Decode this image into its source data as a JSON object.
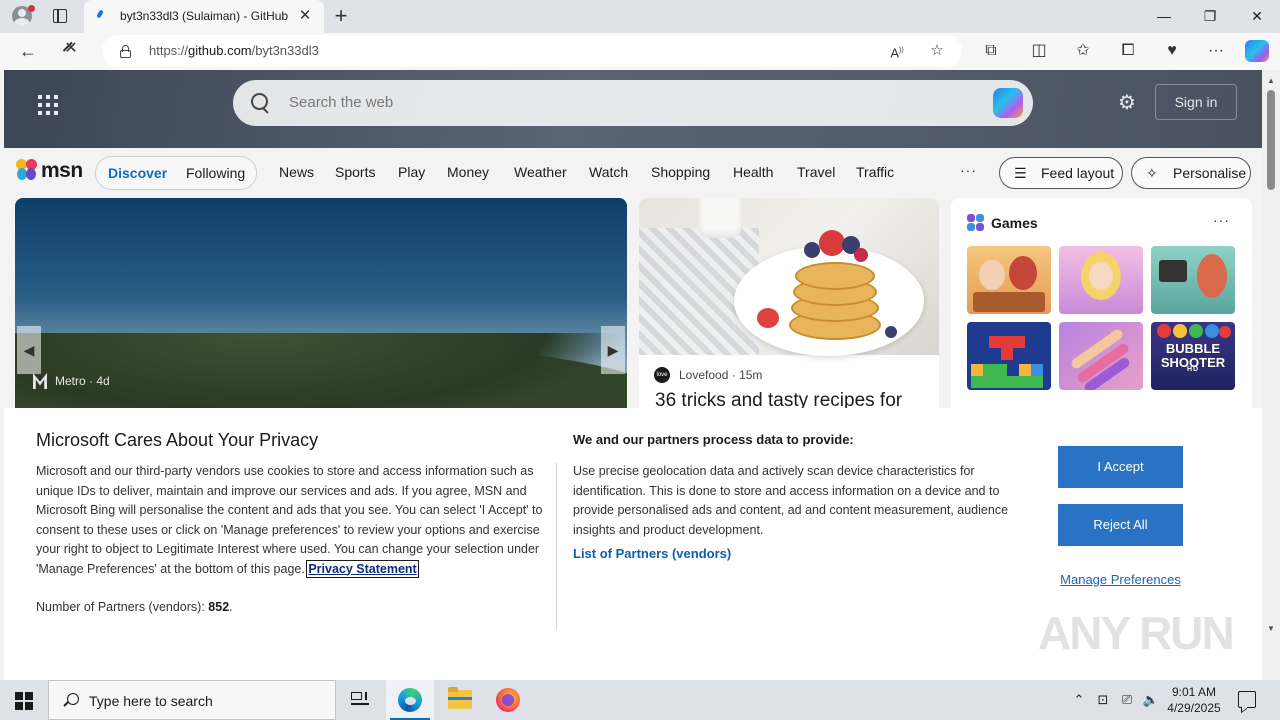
{
  "browser": {
    "tab_title": "byt3n33dl3 (Sulaiman) - GitHub",
    "url_scheme": "https://",
    "url_host": "github.com",
    "url_path": "/byt3n33dl3",
    "icons": [
      "profile-icon",
      "tab-actions-icon",
      "github-favicon",
      "close-icon",
      "plus-icon",
      "back-icon",
      "stop-loading-icon",
      "lock-icon",
      "read-aloud-icon",
      "favorite-star-icon",
      "extensions-icon",
      "split-screen-icon",
      "favorites-icon",
      "collections-icon",
      "performance-icon",
      "more-icon",
      "copilot-icon"
    ],
    "window_controls": {
      "minimize": "—",
      "restore": "❐",
      "close": "✕"
    }
  },
  "msn": {
    "search_placeholder": "Search the web",
    "sign_in": "Sign in",
    "logo_text": "msn",
    "segment": [
      "Discover",
      "Following"
    ],
    "nav_links": [
      "News",
      "Sports",
      "Play",
      "Money",
      "Weather",
      "Watch",
      "Shopping",
      "Health",
      "Travel",
      "Traffic"
    ],
    "more": "···",
    "feed_layout": "Feed layout",
    "personalise": "Personalise",
    "hero": {
      "source": "Metro",
      "age": "4d"
    },
    "food": {
      "source": "Lovefood",
      "age": "15m",
      "title": "36 tricks and tasty recipes for"
    },
    "games": {
      "title": "Games",
      "more": "···",
      "bubble_title": "BUBBLE SHOOTER",
      "bubble_sub": "HD"
    }
  },
  "privacy": {
    "title": "Microsoft Cares About Your Privacy",
    "body": "Microsoft and our third-party vendors use cookies to store and access information such as unique IDs to deliver, maintain and improve our services and ads. If you agree, MSN and Microsoft Bing will personalise the content and ads that you see. You can select 'I Accept' to consent to these uses or click on 'Manage preferences' to review your options and exercise your right to object to Legitimate Interest where used.  You can change your selection under 'Manage Preferences' at the bottom of this page.",
    "privacy_link": "Privacy Statement",
    "partners_label": "Number of Partners (vendors): ",
    "partners_count": "852",
    "partners_suffix": ".",
    "right_title": "We and our partners process data to provide:",
    "right_body": "Use precise geolocation data and actively scan device characteristics for identification. This is done to store and access information on a device and to provide personalised ads and content, ad and content measurement, audience insights and product development.",
    "list_partners": "List of Partners (vendors)",
    "accept": "I Accept",
    "reject": "Reject All",
    "manage": "Manage Preferences",
    "watermark": "ANY RUN"
  },
  "taskbar": {
    "search_placeholder": "Type here to search",
    "time": "9:01 AM",
    "date": "4/29/2025"
  }
}
